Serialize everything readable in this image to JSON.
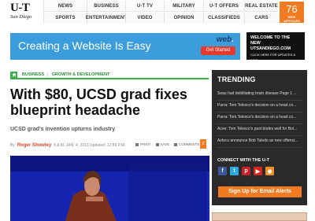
{
  "logo": {
    "main": "U-T",
    "sub": "San Diego"
  },
  "nav": {
    "row1": [
      "NEWS",
      "BUSINESS",
      "U-T TV",
      "MILITARY",
      "U-T OFFERS",
      "REAL ESTATE"
    ],
    "row2": [
      "SPORTS",
      "ENTERTAINMENT",
      "VIDEO",
      "OPINION",
      "CLASSIFIEDS",
      "CARS"
    ]
  },
  "new_articles": {
    "count": "76",
    "label": "NEW ARTICLES"
  },
  "ad": {
    "headline": "Creating a Website Is Easy",
    "brand_main": "web",
    "brand_suffix": ".",
    "button": "Get Started"
  },
  "promo": {
    "line1": "WELCOME TO THE",
    "line2": "NEW UTSANDIEGO.COM",
    "line3": "CLICK HERE FOR UPDATES & INFO"
  },
  "breadcrumb": {
    "items": [
      "BUSINESS",
      "GROWTH & DEVELOPMENT"
    ],
    "separator": "|"
  },
  "article": {
    "title": "With $80, UCSD grad fixes blueprint headache",
    "subtitle": "UCSD grad's invention upturns industry",
    "by": "By",
    "author": "Roger Showley",
    "meta": "6 A.M. JAN. 4, 2013   Updated: 12:56 P.M.",
    "tools": [
      "PRINT",
      "SAVE",
      "COMMENTS"
    ],
    "comments_count": "0"
  },
  "sidebar": {
    "trending_title": "TRENDING",
    "trending": [
      "Seau had debilitating brain disease Page 1 ...",
      "Parra: Tom Telesco's decision on a head co...",
      "Parra: Tom Telesco's decision on a head co...",
      "Acee: Tom Telesco's past bodes well for Bol...",
      "Aztecs announce Bob Toledo as new offensi..."
    ],
    "connect_label": "CONNECT WITH THE U-T",
    "social": [
      {
        "icon": "facebook-icon",
        "glyph": "f",
        "color": "#3b5998"
      },
      {
        "icon": "twitter-icon",
        "glyph": "t",
        "color": "#2aa9e0"
      },
      {
        "icon": "pinterest-icon",
        "glyph": "p",
        "color": "#cb2027"
      },
      {
        "icon": "youtube-icon",
        "glyph": "▶",
        "color": "#d9251d"
      },
      {
        "icon": "rss-icon",
        "glyph": "◉",
        "color": "#f28c1f"
      }
    ],
    "signup_label": "Sign Up for Email Alerts"
  }
}
